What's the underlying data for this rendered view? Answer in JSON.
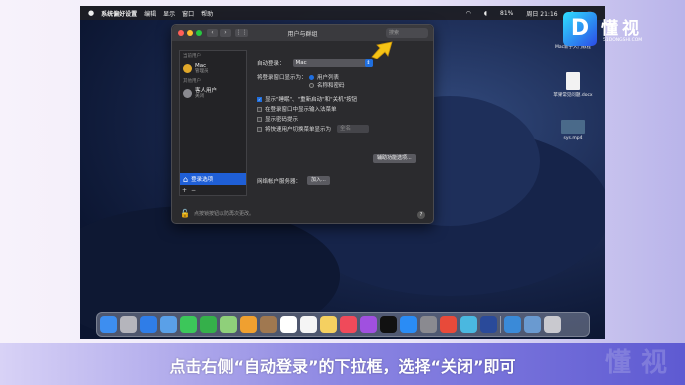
{
  "menubar": {
    "app_name": "系统偏好设置",
    "menus": [
      "编辑",
      "显示",
      "窗口",
      "帮助"
    ],
    "battery": "81%",
    "datetime": "周日 21:16"
  },
  "window": {
    "title": "用户与群组",
    "search_placeholder": "搜索",
    "sidebar": {
      "current_user_group": "当前用户",
      "current_user_name": "Mac",
      "current_user_role": "管理员",
      "other_users_group": "其他用户",
      "guest_name": "客人用户",
      "guest_role": "关闭",
      "login_options_label": "登录选项",
      "plus": "+",
      "minus": "−"
    },
    "panel": {
      "auto_login_label": "自动登录：",
      "auto_login_value": "Mac",
      "display_login_as_label": "将登录窗口显示为：",
      "radio_list": "用户列表",
      "radio_name_password": "名称和密码",
      "cb_show_buttons": "显示\"睡眠\"、\"重新启动\"和\"关机\"按钮",
      "cb_input_menu": "在登录窗口中显示输入法菜单",
      "cb_password_hints": "显示密码提示",
      "cb_fast_switch": "将快速用户切换菜单显示为",
      "fast_switch_value": "全名",
      "accessibility_button": "辅助功能选项...",
      "network_server_label": "网络帐户服务器：",
      "join_button": "加入..."
    },
    "lock_text": "点按锁按钮以防再次更改。",
    "help": "?"
  },
  "desktop": {
    "files": [
      "Mac新手入门教程",
      "苹果常见问题.docx",
      "sys.mp4"
    ]
  },
  "brand": {
    "logo_glyph": "D",
    "name": "懂视",
    "sub": "51DONGSHI.COM",
    "watermark": "懂视"
  },
  "caption": "点击右侧“自动登录”的下拉框，选择“关闭”即可",
  "colors": {
    "accent_blue": "#1f6fe0",
    "arrow_yellow": "#f6c415"
  }
}
